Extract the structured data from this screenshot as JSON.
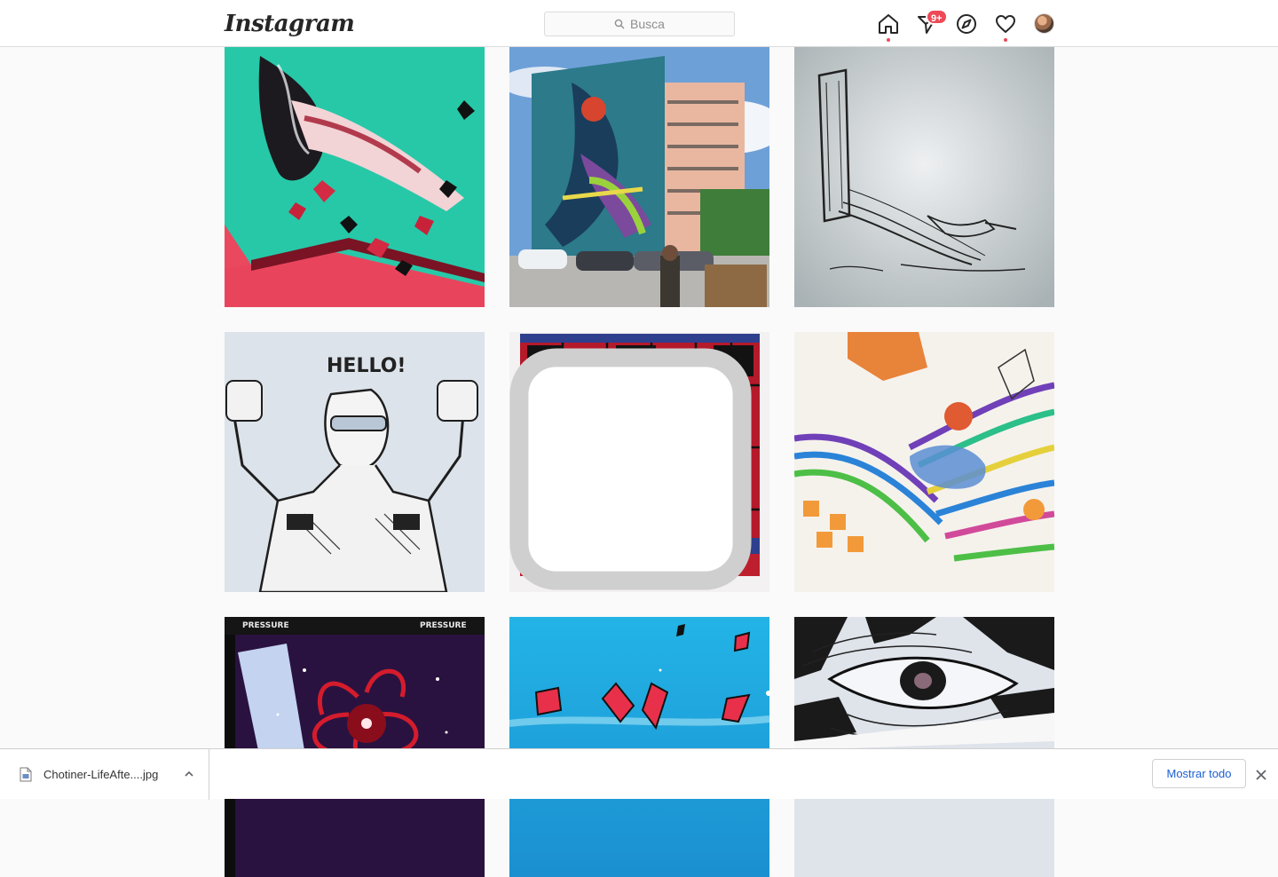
{
  "header": {
    "logo_text": "Instagram",
    "search_placeholder": "Busca",
    "notification_badge": "9+",
    "icons": [
      "home-icon",
      "direct-icon",
      "explore-icon",
      "activity-icon",
      "avatar"
    ]
  },
  "posts": [
    {
      "id": "post-1",
      "subject": "turquoise-red-figure-mural"
    },
    {
      "id": "post-2",
      "subject": "building-mural-photo"
    },
    {
      "id": "post-3",
      "subject": "ink-sketch-grey"
    },
    {
      "id": "post-4",
      "subject": "hello-sketch",
      "caption_in_image": "HELLO!"
    },
    {
      "id": "post-5",
      "subject": "red-black-grid-painting",
      "multiple": true
    },
    {
      "id": "post-6",
      "subject": "colorful-marker-drawing"
    },
    {
      "id": "post-7",
      "subject": "red-hair-poster",
      "caption_in_image": "PRESSURE"
    },
    {
      "id": "post-8",
      "subject": "blue-red-shards"
    },
    {
      "id": "post-9",
      "subject": "bw-eye-closeup"
    }
  ],
  "download_shelf": {
    "file_name": "Chotiner-LifeAfte....jpg",
    "show_all_label": "Mostrar todo"
  },
  "colors": {
    "notification_red": "#ed4956",
    "link_blue": "#1a5fd1",
    "border": "#dbdbdb"
  }
}
